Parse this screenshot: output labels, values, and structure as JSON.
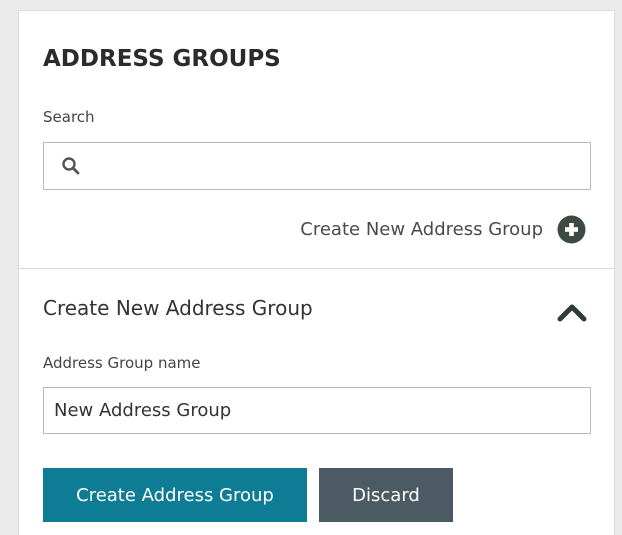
{
  "panel": {
    "title": "ADDRESS GROUPS",
    "search": {
      "label": "Search",
      "value": "",
      "placeholder": "",
      "icon": "search-icon"
    },
    "create_link": {
      "label": "Create New Address Group",
      "icon": "plus-circle-icon"
    }
  },
  "create_section": {
    "title": "Create New Address Group",
    "toggle_icon": "chevron-up-icon",
    "expanded": true,
    "name_field": {
      "label": "Address Group name",
      "value": "New Address Group"
    },
    "buttons": {
      "create_label": "Create Address Group",
      "discard_label": "Discard"
    }
  },
  "colors": {
    "primary_button": "#0e7c95",
    "secondary_button": "#4b5a63",
    "icon_dark": "#3d4a42",
    "background": "#ebebeb",
    "panel": "#ffffff"
  }
}
